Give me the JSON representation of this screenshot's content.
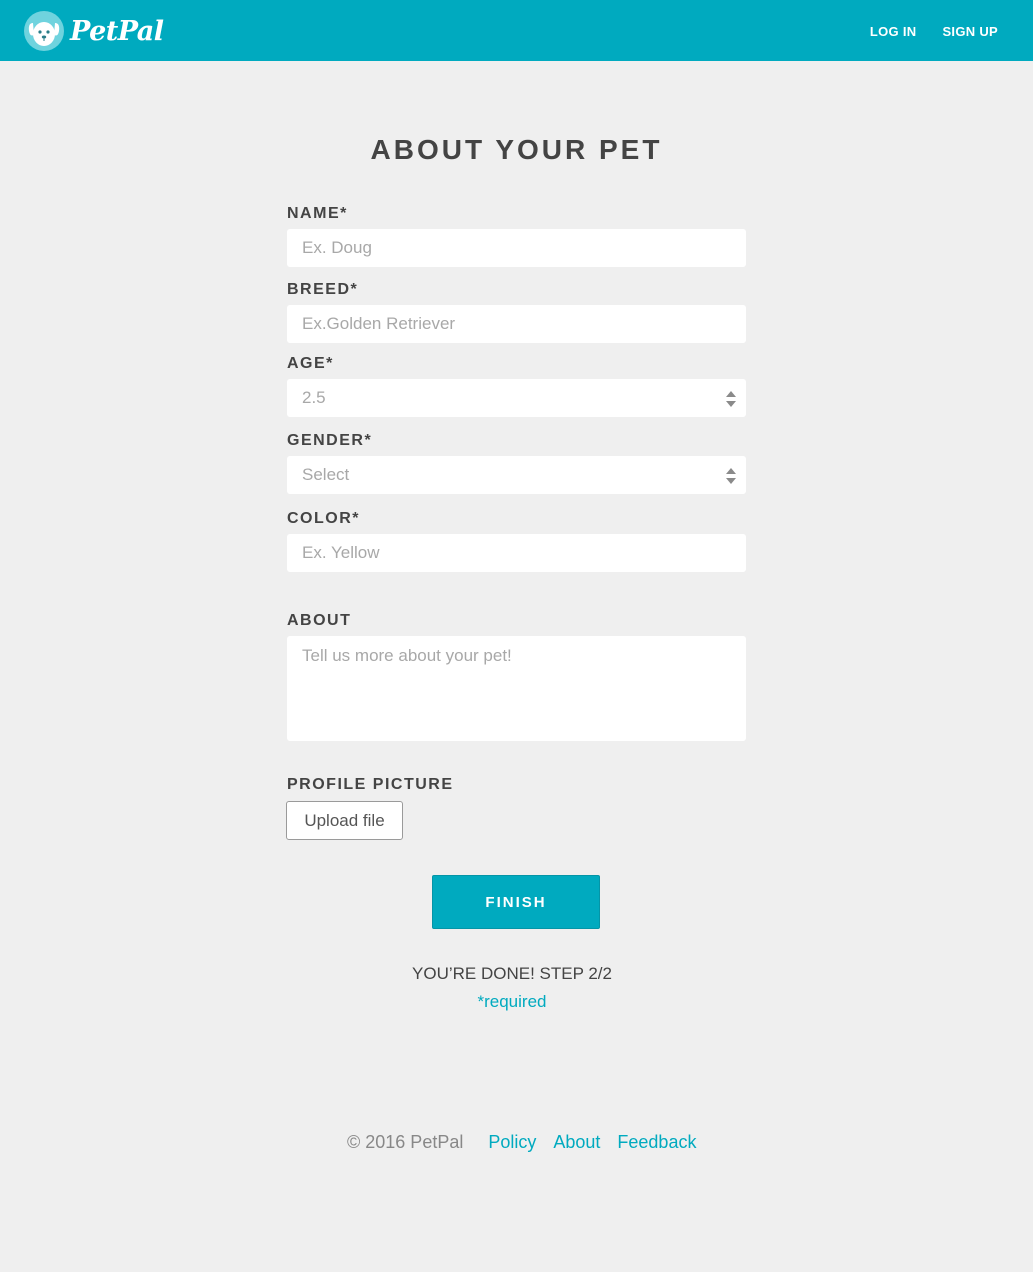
{
  "header": {
    "brand": "PetPal",
    "nav": {
      "login": "LOG IN",
      "signup": "SIGN UP"
    },
    "brand_color": "#00aabf"
  },
  "form": {
    "title": "ABOUT YOUR PET",
    "name": {
      "label": "NAME*",
      "placeholder": "Ex. Doug"
    },
    "breed": {
      "label": "BREED*",
      "placeholder": "Ex.Golden Retriever"
    },
    "age": {
      "label": "AGE*",
      "value": "2.5"
    },
    "gender": {
      "label": "GENDER*",
      "value": "Select"
    },
    "color": {
      "label": "COLOR*",
      "placeholder": "Ex. Yellow"
    },
    "about": {
      "label": "ABOUT",
      "placeholder": "Tell us more about your pet!"
    },
    "profile_picture": {
      "label": "PROFILE PICTURE",
      "button": "Upload file"
    },
    "finish_button": "FINISH",
    "step_text": "YOU’RE DONE! STEP 2/2",
    "required_note": "*required"
  },
  "footer": {
    "copyright": "© 2016 PetPal",
    "links": [
      "Policy",
      "About",
      "Feedback"
    ]
  }
}
